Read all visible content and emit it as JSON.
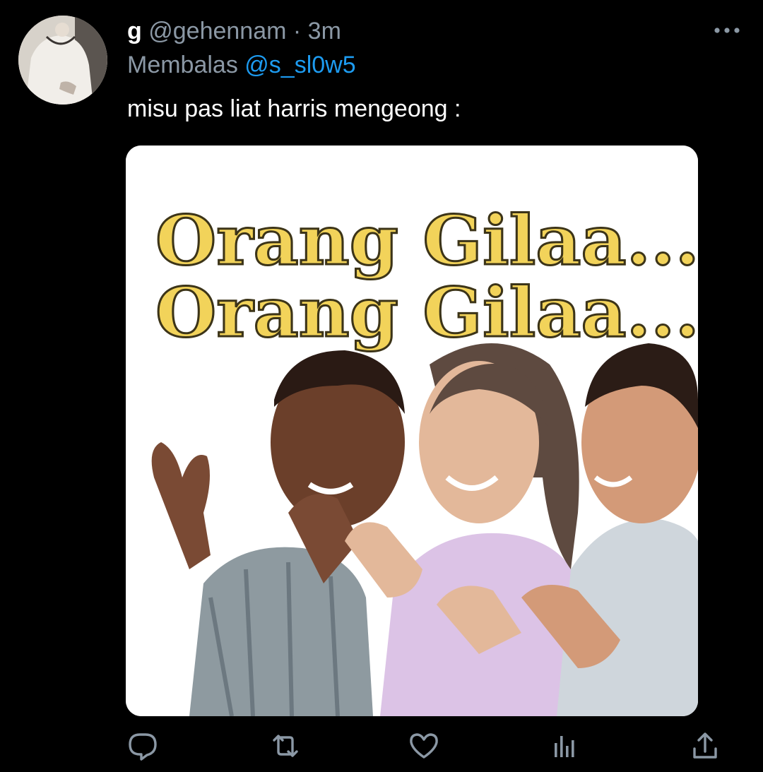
{
  "tweet": {
    "display_name": "g",
    "handle": "@gehennam",
    "separator": "·",
    "time": "3m",
    "reply_prefix": "Membalas",
    "reply_to": "@s_sl0w5",
    "text": "misu pas liat harris mengeong :"
  },
  "media": {
    "caption_line_1": "Orang Gilaa...",
    "caption_line_2": "Orang Gilaa...",
    "caption_color": "#f2d35a"
  },
  "actions": {
    "icons": [
      "reply-icon",
      "retweet-icon",
      "like-icon",
      "analytics-icon",
      "share-icon"
    ]
  },
  "colors": {
    "background": "#000000",
    "secondary_text": "#8b98a5",
    "link": "#1d9bf0"
  }
}
